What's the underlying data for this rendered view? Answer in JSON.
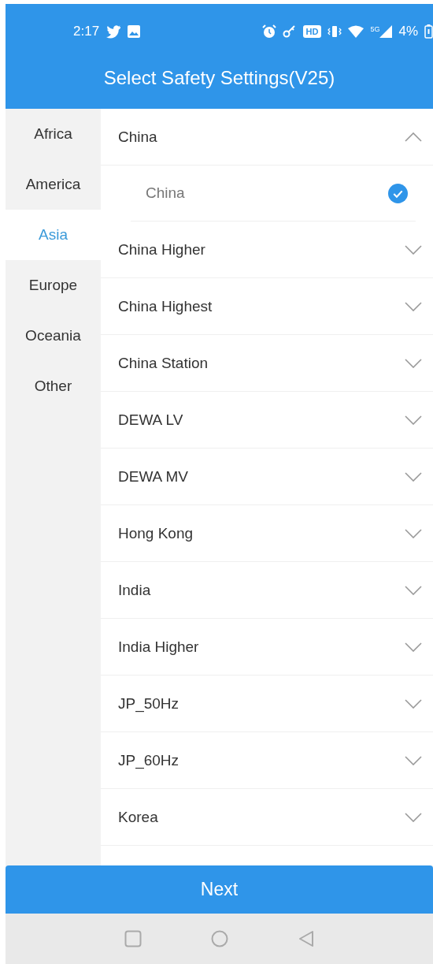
{
  "status_bar": {
    "time": "2:17",
    "hd": "HD",
    "network": "5G",
    "battery": "4%"
  },
  "header": {
    "title": "Select Safety Settings(V25)"
  },
  "regions": [
    {
      "label": "Africa",
      "selected": false
    },
    {
      "label": "America",
      "selected": false
    },
    {
      "label": "Asia",
      "selected": true
    },
    {
      "label": "Europe",
      "selected": false
    },
    {
      "label": "Oceania",
      "selected": false
    },
    {
      "label": "Other",
      "selected": false
    }
  ],
  "groups": [
    {
      "label": "China",
      "expanded": true,
      "children": [
        {
          "label": "China",
          "checked": true
        }
      ]
    },
    {
      "label": "China Higher",
      "expanded": false
    },
    {
      "label": "China Highest",
      "expanded": false
    },
    {
      "label": "China Station",
      "expanded": false
    },
    {
      "label": "DEWA LV",
      "expanded": false
    },
    {
      "label": "DEWA MV",
      "expanded": false
    },
    {
      "label": "Hong Kong",
      "expanded": false
    },
    {
      "label": "India",
      "expanded": false
    },
    {
      "label": "India Higher",
      "expanded": false
    },
    {
      "label": "JP_50Hz",
      "expanded": false
    },
    {
      "label": "JP_60Hz",
      "expanded": false
    },
    {
      "label": "Korea",
      "expanded": false
    }
  ],
  "next_button": "Next"
}
